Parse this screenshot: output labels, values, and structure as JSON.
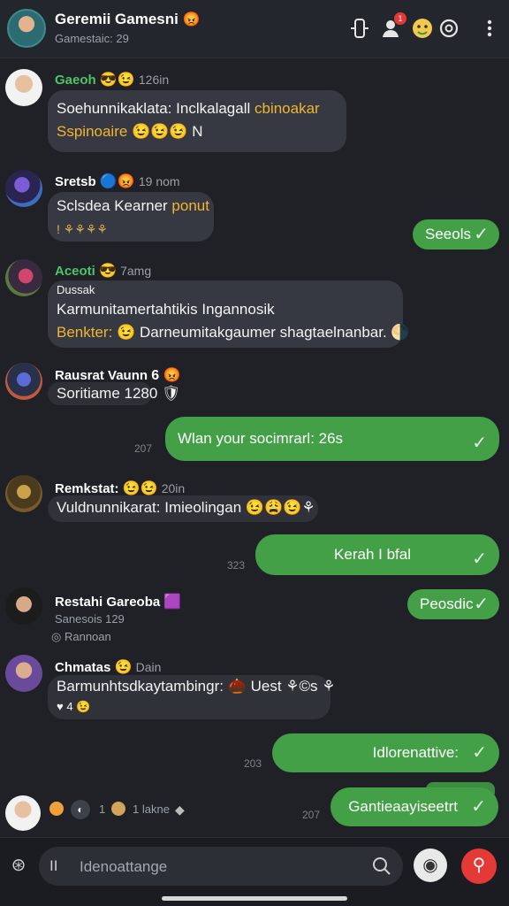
{
  "header": {
    "title": "Geremii Gamesni",
    "title_emoji": "😡",
    "subtitle": "Gamestaic: 29",
    "icons": [
      "controller-icon",
      "add-user-icon",
      "emoji-icon",
      "settings-icon",
      "more-icon"
    ],
    "notification_count": "1"
  },
  "messages": [
    {
      "name": "Gaeoh",
      "name_emoji": "😎😉",
      "meta": "126in",
      "line1_a": "Soehunnikaklata: Inclkalagall ",
      "line1_b": "cbinoakar",
      "line2_a": "Sspinoaire",
      "line2_emoji": "😉😉😉",
      "line2_b": " N"
    },
    {
      "name": "Sretsb",
      "name_emoji": "🔵😡",
      "meta": "19 nom",
      "line1_a": "Sclsdea Kearner ",
      "line1_b": "ponut",
      "line2_a": "! ⚘⚘⚘⚘",
      "line2_b": ""
    },
    {
      "name": "Aceoti",
      "name_emoji": "😎",
      "meta": "7amg",
      "label": "Dussak",
      "line1_a": "Karmunitamertahtikis Ingannosik",
      "line2_a": "Benkter:",
      "line2_emoji": "😉",
      "line2_b": " Darneumitakgaumer shagtaelnanbar. 🌗"
    },
    {
      "name": "Rausrat Vaunn",
      "name_emoji": "6 😡",
      "meta": "",
      "line1_a": "Soritiame 1280",
      "line1_b": " 🛡"
    },
    {
      "name": "Remkstat:",
      "name_emoji": "😉😉",
      "meta": "20in",
      "line1_a": "Vuldnunnikarat: Imieolingan",
      "line1_emoji": "😉😩😉⚘"
    },
    {
      "name": "Restahi Gareoba",
      "name_emoji": "🟪",
      "meta": "",
      "line1_a": "Sanesois 129",
      "line2_a": "Rannoan"
    },
    {
      "name": "Chmatas",
      "name_emoji": "😉",
      "meta": "Dain",
      "line1_a": "Barmunhtsdkaytambingr: ",
      "line1_emoji": "🌰",
      "line1_b": " Uest ⚘©s ⚘",
      "line2_a": "♥ 4 😉"
    }
  ],
  "outgoing": [
    {
      "text": "Seeols",
      "time": ""
    },
    {
      "text": "Wlan your socimrarl: 26s",
      "time": "207"
    },
    {
      "text": "Kerah I bfal",
      "time": "323"
    },
    {
      "text": "Peosdic",
      "time": ""
    },
    {
      "text": "Idlorenattive:",
      "time": "203"
    },
    {
      "text": "Gantieaayiseetrt",
      "time": "207"
    }
  ],
  "footer_row": {
    "count": "1",
    "label": "1 lakne"
  },
  "input": {
    "placeholder": "Idenoattange",
    "pause_glyph": "II"
  },
  "colors": {
    "outgoing": "#43a047",
    "incoming": "#363942",
    "accent_red": "#e53935"
  }
}
